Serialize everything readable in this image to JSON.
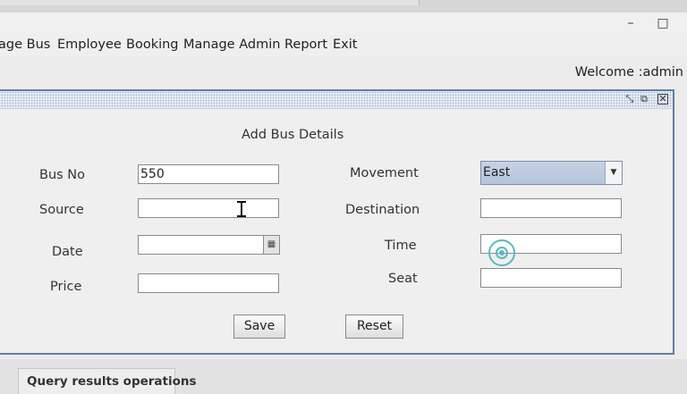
{
  "window": {
    "minimize_label": "–",
    "maximize_label": "□"
  },
  "menu": [
    {
      "label": "age Bus"
    },
    {
      "label": "Employee"
    },
    {
      "label": "Booking"
    },
    {
      "label": "Manage Admin"
    },
    {
      "label": "Report"
    },
    {
      "label": "Exit"
    }
  ],
  "welcome": "Welcome :admin",
  "form": {
    "title": "Add Bus Details",
    "bus_no": {
      "label": "Bus No",
      "value": "550"
    },
    "source": {
      "label": "Source",
      "value": ""
    },
    "date": {
      "label": "Date",
      "value": ""
    },
    "price": {
      "label": "Price",
      "value": ""
    },
    "movement": {
      "label": "Movement",
      "selected": "East"
    },
    "destination": {
      "label": "Destination",
      "value": ""
    },
    "time": {
      "label": "Time",
      "value": ""
    },
    "seat": {
      "label": "Seat",
      "value": ""
    },
    "save_label": "Save",
    "reset_label": "Reset"
  },
  "bottom_tab": {
    "label": "Query results operations"
  },
  "icons": {
    "minimize": "minimize-icon",
    "maximize": "maximize-icon",
    "frame_iconify": "iconify-icon",
    "frame_maximize": "frame-maximize-icon",
    "frame_close": "close-icon",
    "combo_arrow": "chevron-down-icon",
    "calendar": "calendar-icon"
  },
  "colors": {
    "frame_border": "#5f7fa5",
    "combo_selected": "#b4c4dc",
    "click_indicator": "#5bb8bf"
  }
}
